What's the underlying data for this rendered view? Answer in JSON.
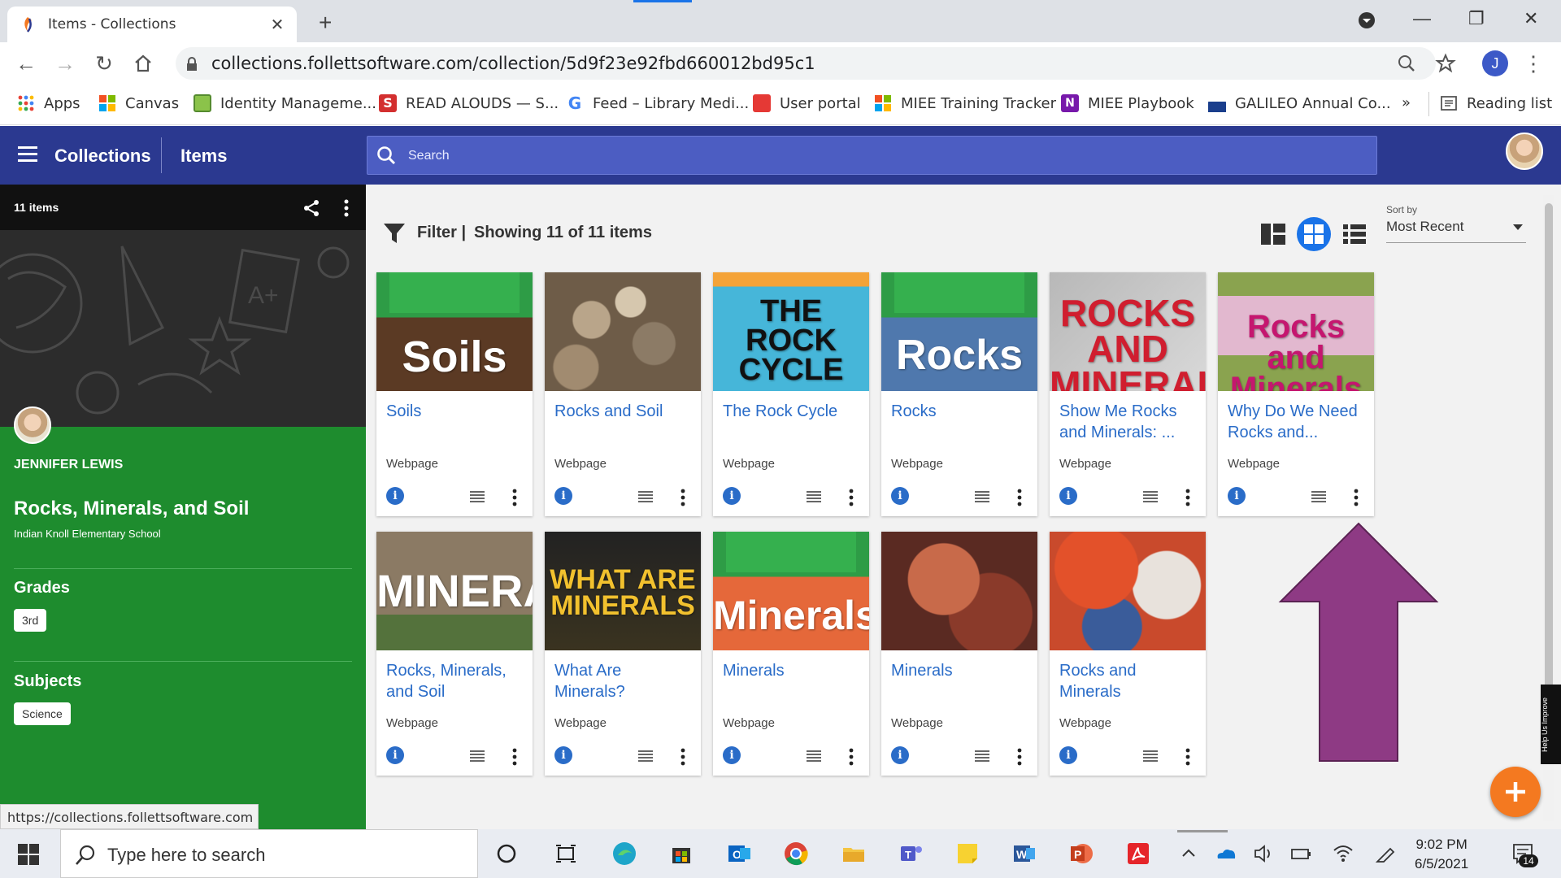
{
  "browser": {
    "tab_title": "Items - Collections",
    "url": "collections.follettsoftware.com/collection/5d9f23e92fbd660012bd95c1",
    "bookmarks": [
      "Apps",
      "Canvas",
      "Identity Manageme...",
      "READ ALOUDS — S...",
      "Feed – Library Medi...",
      "User portal",
      "MIEE Training Tracker",
      "MIEE Playbook",
      "GALILEO Annual Co..."
    ],
    "reading_list": "Reading list",
    "overflow": "»"
  },
  "header": {
    "collections": "Collections",
    "items": "Items",
    "search_placeholder": "Search"
  },
  "sidebar": {
    "item_count": "11 items",
    "owner": "JENNIFER LEWIS",
    "collection_title": "Rocks, Minerals, and Soil",
    "school": "Indian Knoll Elementary School",
    "grades_heading": "Grades",
    "grades": [
      "3rd"
    ],
    "subjects_heading": "Subjects",
    "subjects": [
      "Science"
    ]
  },
  "status_url": "https://collections.follettsoftware.com",
  "toolbar": {
    "filter": "Filter |",
    "showing": "Showing 11 of 11 items",
    "sort_label": "Sort by",
    "sort_value": "Most Recent"
  },
  "items": [
    {
      "title": "Soils",
      "type": "Webpage",
      "thumb_text": "Soils"
    },
    {
      "title": "Rocks and Soil",
      "type": "Webpage",
      "thumb_text": ""
    },
    {
      "title": "The Rock Cycle",
      "type": "Webpage",
      "thumb_text": "THE ROCK CYCLE"
    },
    {
      "title": "Rocks",
      "type": "Webpage",
      "thumb_text": "Rocks"
    },
    {
      "title": "Show Me Rocks and Minerals: ...",
      "type": "Webpage",
      "thumb_text": "ROCKS AND MINERALS"
    },
    {
      "title": "Why Do We Need Rocks and...",
      "type": "Webpage",
      "thumb_text": "Rocks and Minerals"
    },
    {
      "title": "Rocks, Minerals, and Soil",
      "type": "Webpage",
      "thumb_text": "MINERAL and"
    },
    {
      "title": "What Are Minerals?",
      "type": "Webpage",
      "thumb_text": "WHAT ARE MINERALS"
    },
    {
      "title": "Minerals",
      "type": "Webpage",
      "thumb_text": "Minerals"
    },
    {
      "title": "Minerals",
      "type": "Webpage",
      "thumb_text": ""
    },
    {
      "title": "Rocks and Minerals",
      "type": "Webpage",
      "thumb_text": ""
    }
  ],
  "help_tab": "Help Us Improve",
  "taskbar": {
    "search_placeholder": "Type here to search",
    "time": "9:02 PM",
    "date": "6/5/2021",
    "notifications": "14"
  },
  "colors": {
    "app_header": "#2b3990",
    "sidebar_green": "#1e8c2e",
    "link_blue": "#2a6cc8",
    "fab_orange": "#f47920",
    "annotation_arrow": "#8e3a84"
  }
}
